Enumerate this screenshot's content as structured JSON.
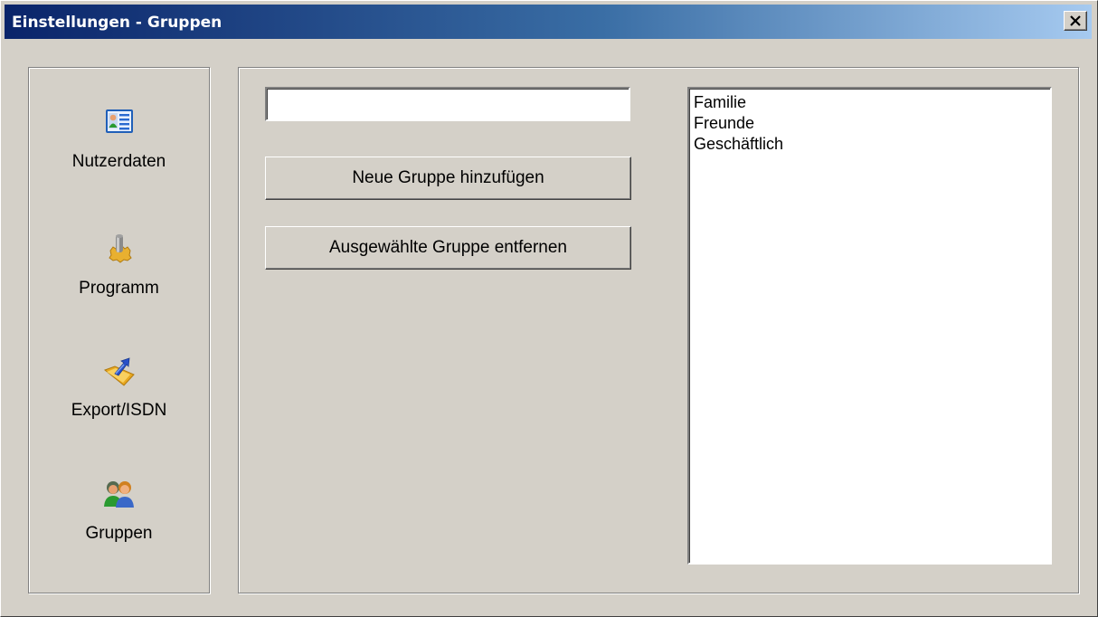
{
  "window": {
    "title": "Einstellungen - Gruppen",
    "close_label": "Schließen"
  },
  "sidebar": {
    "items": [
      {
        "label": "Nutzerdaten",
        "icon": "user-card-icon"
      },
      {
        "label": "Programm",
        "icon": "program-settings-icon"
      },
      {
        "label": "Export/ISDN",
        "icon": "export-folder-icon"
      },
      {
        "label": "Gruppen",
        "icon": "group-users-icon"
      }
    ]
  },
  "main": {
    "group_name_input": {
      "value": "",
      "placeholder": ""
    },
    "add_button_label": "Neue Gruppe hinzufügen",
    "remove_button_label": "Ausgewählte Gruppe entfernen",
    "groups": [
      "Familie",
      "Freunde",
      "Geschäftlich"
    ]
  },
  "colors": {
    "face": "#d4d0c8",
    "title_start": "#0a246a",
    "title_end": "#a6caf0"
  }
}
